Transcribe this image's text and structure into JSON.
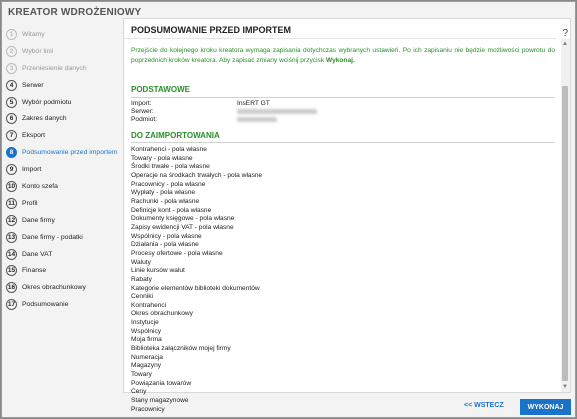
{
  "app": {
    "title": "KREATOR WDROŻENIOWY"
  },
  "steps": [
    {
      "n": "1",
      "label": "Witamy",
      "state": "done"
    },
    {
      "n": "2",
      "label": "Wybór linii",
      "state": "done"
    },
    {
      "n": "3",
      "label": "Przeniesienie danych",
      "state": "done"
    },
    {
      "n": "4",
      "label": "Serwer",
      "state": "normal"
    },
    {
      "n": "5",
      "label": "Wybór podmiotu",
      "state": "normal"
    },
    {
      "n": "6",
      "label": "Zakres danych",
      "state": "normal"
    },
    {
      "n": "7",
      "label": "Eksport",
      "state": "normal"
    },
    {
      "n": "8",
      "label": "Podsumowanie przed importem",
      "state": "active"
    },
    {
      "n": "9",
      "label": "Import",
      "state": "normal"
    },
    {
      "n": "10",
      "label": "Konto szefa",
      "state": "normal"
    },
    {
      "n": "11",
      "label": "Profil",
      "state": "normal"
    },
    {
      "n": "12",
      "label": "Dane firmy",
      "state": "normal"
    },
    {
      "n": "13",
      "label": "Dane firmy - podatki",
      "state": "normal"
    },
    {
      "n": "14",
      "label": "Dane VAT",
      "state": "normal"
    },
    {
      "n": "15",
      "label": "Finanse",
      "state": "normal"
    },
    {
      "n": "16",
      "label": "Okres obrachunkowy",
      "state": "normal"
    },
    {
      "n": "17",
      "label": "Podsumowanie",
      "state": "normal"
    }
  ],
  "main": {
    "title": "PODSUMOWANIE PRZED IMPORTEM",
    "help": "?",
    "info_text": "Przejście do kolejnego kroku kreatora wymaga zapisania dotychczas wybranych ustawień. Po ich zapisaniu nie będzie możliwości powrotu do poprzednich kroków kreatora. Aby zapisać zmiany wciśnij przycisk ",
    "info_bold": "Wykonaj.",
    "basic_title": "PODSTAWOWE",
    "basic": [
      {
        "key": "Import:",
        "value": "InsERT GT"
      },
      {
        "key": "Serwer:",
        "value": ""
      },
      {
        "key": "Podmiot:",
        "value": ""
      }
    ],
    "import_title": "DO ZAIMPORTOWANIA",
    "import_items": [
      "Kontrahenci - pola własne",
      "Towary - pola własne",
      "Środki trwałe - pola własne",
      "Operacje na środkach trwałych - pola własne",
      "Pracownicy - pola własne",
      "Wypłaty - pola własne",
      "Rachunki - pola własne",
      "Definicje kont - pola własne",
      "Dokumenty księgowe - pola własne",
      "Zapisy ewidencji VAT - pola własne",
      "Wspólnicy - pola własne",
      "Działania - pola własne",
      "Procesy ofertowe - pola własne",
      "Waluty",
      "Linie kursów walut",
      "Rabaty",
      "Kategorie elementów biblioteki dokumentów",
      "Cenniki",
      "Kontrahenci",
      "Okres obrachunkowy",
      "Instytucje",
      "Wspólnicy",
      "Moja firma",
      "Biblioteka załączników mojej firmy",
      "Numeracja",
      "Magazyny",
      "Towary",
      "Powiązania towarów",
      "Ceny",
      "Stany magazynowe",
      "Pracownicy"
    ]
  },
  "footer": {
    "back_label": "<< WSTECZ",
    "run_label": "WYKONAJ"
  },
  "colors": {
    "accent": "#1a73c8",
    "green": "#2a8f2a"
  }
}
